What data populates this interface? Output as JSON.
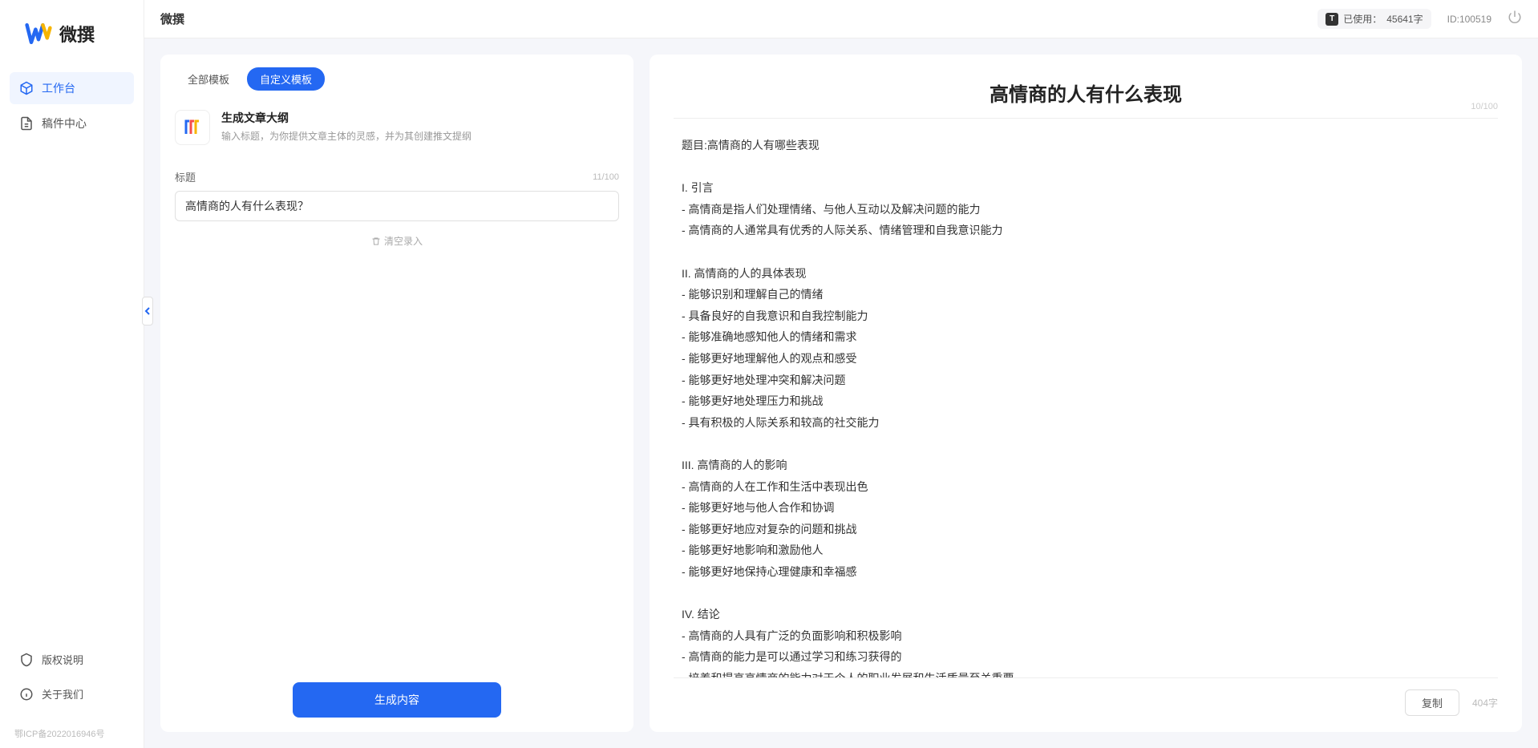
{
  "app": {
    "name": "微撰",
    "logo_letter": "W"
  },
  "sidebar": {
    "items": [
      {
        "label": "工作台",
        "icon": "cube"
      },
      {
        "label": "稿件中心",
        "icon": "doc"
      }
    ],
    "footer": [
      {
        "label": "版权说明",
        "icon": "shield"
      },
      {
        "label": "关于我们",
        "icon": "info"
      }
    ],
    "icp": "鄂ICP备2022016946号"
  },
  "topbar": {
    "title": "微撰",
    "usage_prefix": "已使用：",
    "usage_value": "45641字",
    "id_label": "ID:100519"
  },
  "tabs": {
    "all": "全部模板",
    "custom": "自定义模板"
  },
  "template": {
    "title": "生成文章大纲",
    "desc": "输入标题，为你提供文章主体的灵感，并为其创建推文提纲"
  },
  "form": {
    "label": "标题",
    "count": "11/100",
    "value": "高情商的人有什么表现？",
    "clear": "清空录入"
  },
  "actions": {
    "generate": "生成内容",
    "copy": "复制"
  },
  "output": {
    "title": "高情商的人有什么表现",
    "top_count": "10/100",
    "word_count": "404字",
    "body": "题目:高情商的人有哪些表现\n\nI. 引言\n- 高情商是指人们处理情绪、与他人互动以及解决问题的能力\n- 高情商的人通常具有优秀的人际关系、情绪管理和自我意识能力\n\nII. 高情商的人的具体表现\n- 能够识别和理解自己的情绪\n- 具备良好的自我意识和自我控制能力\n- 能够准确地感知他人的情绪和需求\n- 能够更好地理解他人的观点和感受\n- 能够更好地处理冲突和解决问题\n- 能够更好地处理压力和挑战\n- 具有积极的人际关系和较高的社交能力\n\nIII. 高情商的人的影响\n- 高情商的人在工作和生活中表现出色\n- 能够更好地与他人合作和协调\n- 能够更好地应对复杂的问题和挑战\n- 能够更好地影响和激励他人\n- 能够更好地保持心理健康和幸福感\n\nIV. 结论\n- 高情商的人具有广泛的负面影响和积极影响\n- 高情商的能力是可以通过学习和练习获得的\n- 培养和提高高情商的能力对于个人的职业发展和生活质量至关重要。"
  }
}
